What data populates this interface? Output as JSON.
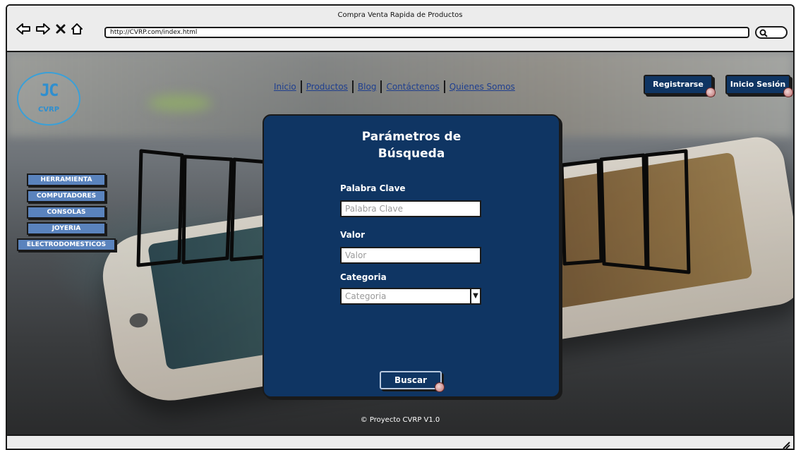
{
  "window": {
    "title": "Compra Venta Rapida de Productos",
    "url": "http://CVRP.com/index.html"
  },
  "icons": {
    "back": "back-arrow-icon",
    "forward": "forward-arrow-icon",
    "stop": "stop-x-icon",
    "home": "home-icon",
    "search": "search-icon",
    "badge": "flag-badge-icon",
    "resize": "resize-grip-icon"
  },
  "logo": {
    "mark": "JC",
    "text": "CVRP"
  },
  "nav": {
    "links": [
      "Inicio",
      "Productos",
      "Blog",
      "Contáctenos",
      "Quienes Somos"
    ]
  },
  "auth": {
    "register_label": "Registrarse",
    "login_label": "Inicio Sesión"
  },
  "categories": [
    "HERRAMIENTA",
    "COMPUTADORES",
    "CONSOLAS",
    "JOYERIA",
    "ELECTRODOMESTICOS"
  ],
  "search_panel": {
    "title_line1": "Parámetros de",
    "title_line2": "Búsqueda",
    "keyword_label": "Palabra Clave",
    "keyword_placeholder": "Palabra Clave",
    "value_label": "Valor",
    "value_placeholder": "Valor",
    "category_label": "Categoria",
    "category_placeholder": "Categoria",
    "submit_label": "Buscar"
  },
  "footer": {
    "text": "© Proyecto CVRP V1.0"
  },
  "colors": {
    "primary": "#0f3563",
    "menu": "#5a83bd",
    "link": "#1f3f8f",
    "logo": "#2f8fcf"
  }
}
